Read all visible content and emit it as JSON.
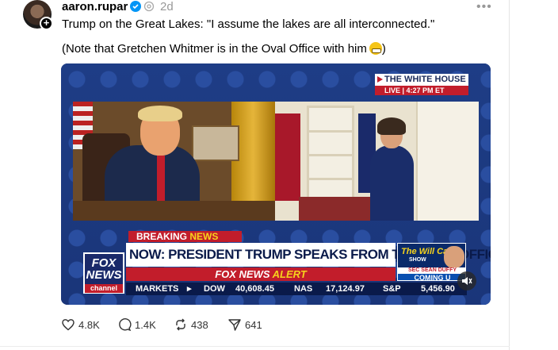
{
  "post": {
    "username": "aaron.rupar",
    "time": "2d",
    "text_line1": "Trump on the Great Lakes: \"I assume the lakes are all interconnected.\"",
    "text_line2": "(Note that Gretchen Whitmer is in the Oval Office with him",
    "text_line2_end": ")"
  },
  "video": {
    "badge_title": "THE WHITE HOUSE",
    "badge_live": "LIVE  |  4:27 PM ET",
    "breaking_a": "BREAKING ",
    "breaking_b": "NEWS",
    "headline": "NOW: PRESIDENT TRUMP SPEAKS FROM THE OVAL OFFICE",
    "alert_a": "FOX NEWS ",
    "alert_b": "ALERT",
    "logo_top": "FOX",
    "logo_mid": "NEWS",
    "logo_channel": "channel",
    "show_title": "The Will Cain",
    "show_sub": "SHOW",
    "show_guest": "SEC SEAN DUFFY",
    "show_coming": "COMING U",
    "ticker": {
      "markets": "MARKETS",
      "dow_label": "DOW",
      "dow_value": "40,608.45",
      "nas_label": "NAS",
      "nas_value": "17,124.97",
      "sp_label": "S&P",
      "sp_value": "5,456.90"
    }
  },
  "actions": {
    "likes": "4.8K",
    "comments": "1.4K",
    "reposts": "438",
    "shares": "641"
  },
  "icons": [
    "plus-icon",
    "verified-icon",
    "thread-icon",
    "more-icon",
    "mute-icon",
    "heart-icon",
    "comment-icon",
    "repost-icon",
    "share-icon"
  ],
  "colors": {
    "verified": "#0095f6",
    "fox_red": "#c21d2b",
    "fox_blue": "#1a2a6a"
  }
}
